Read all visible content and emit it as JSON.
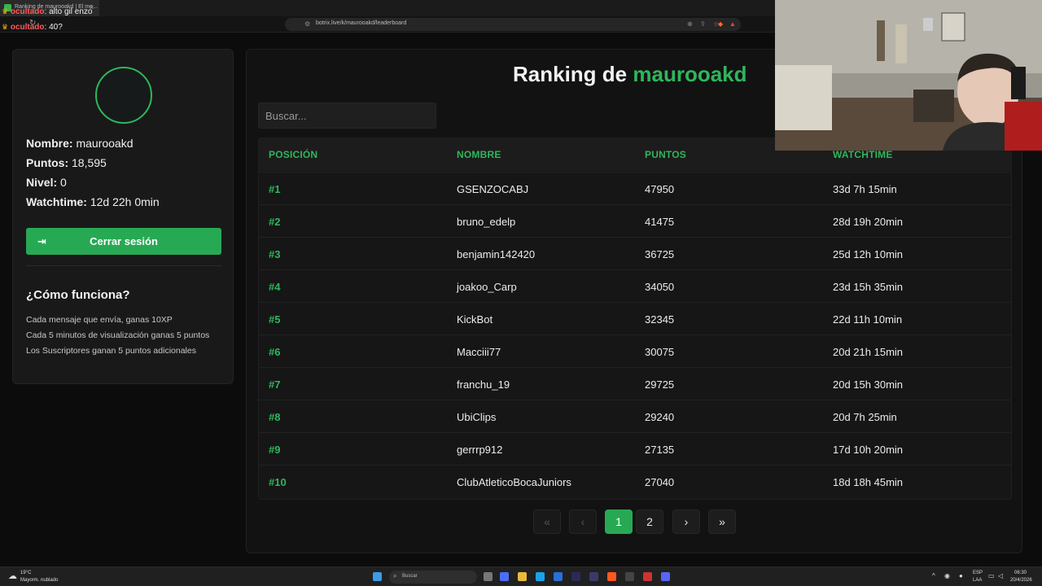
{
  "browser": {
    "tab_title": "Ranking de maurooakd | El me...",
    "url": "botrix.live/k/maurooakd/leaderboard"
  },
  "chat": [
    {
      "user": "ocultado",
      "message": ": alto gil enzo"
    },
    {
      "user": "ocultado",
      "message": ": 40?"
    }
  ],
  "profile": {
    "name_label": "Nombre:",
    "name_value": "maurooakd",
    "points_label": "Puntos:",
    "points_value": "18,595",
    "level_label": "Nivel:",
    "level_value": "0",
    "watch_label": "Watchtime:",
    "watch_value": "12d 22h 0min",
    "logout_label": "Cerrar sesión"
  },
  "how": {
    "title": "¿Cómo funciona?",
    "items": [
      "Cada mensaje que envía, ganas 10XP",
      "Cada 5 minutos de visualización ganas 5 puntos",
      "Los Suscriptores ganan 5 puntos adicionales"
    ]
  },
  "ranking": {
    "title_prefix": "Ranking de",
    "title_user": "maurooakd",
    "search_placeholder": "Buscar...",
    "headers": [
      "POSICIÓN",
      "NOMBRE",
      "PUNTOS",
      "WATCHTIME"
    ],
    "rows": [
      {
        "pos": "#1",
        "name": "GSENZOCABJ",
        "points": "47950",
        "watch": "33d 7h 15min"
      },
      {
        "pos": "#2",
        "name": "bruno_edelp",
        "points": "41475",
        "watch": "28d 19h 20min"
      },
      {
        "pos": "#3",
        "name": "benjamin142420",
        "points": "36725",
        "watch": "25d 12h 10min"
      },
      {
        "pos": "#4",
        "name": "joakoo_Carp",
        "points": "34050",
        "watch": "23d 15h 35min"
      },
      {
        "pos": "#5",
        "name": "KickBot",
        "points": "32345",
        "watch": "22d 11h 10min"
      },
      {
        "pos": "#6",
        "name": "Macciii77",
        "points": "30075",
        "watch": "20d 21h 15min"
      },
      {
        "pos": "#7",
        "name": "franchu_19",
        "points": "29725",
        "watch": "20d 15h 30min"
      },
      {
        "pos": "#8",
        "name": "UbiClips",
        "points": "29240",
        "watch": "20d 7h 25min"
      },
      {
        "pos": "#9",
        "name": "gerrrp912",
        "points": "27135",
        "watch": "17d 10h 20min"
      },
      {
        "pos": "#10",
        "name": "ClubAtleticoBocaJuniors",
        "points": "27040",
        "watch": "18d 18h 45min"
      }
    ]
  },
  "pagination": {
    "first": "«",
    "prev": "‹",
    "pages": [
      "1",
      "2"
    ],
    "current": "1",
    "next": "›",
    "last": "»"
  },
  "taskbar": {
    "weather_temp": "19°C",
    "weather_desc": "Mayorm. nublado",
    "search_label": "Buscar",
    "lang_top": "ESP",
    "lang_bottom": "LAA",
    "time": "06:30",
    "date": "20/4/2026"
  },
  "colors": {
    "accent": "#2fb65d",
    "button": "#27a954",
    "panel": "#121212"
  }
}
